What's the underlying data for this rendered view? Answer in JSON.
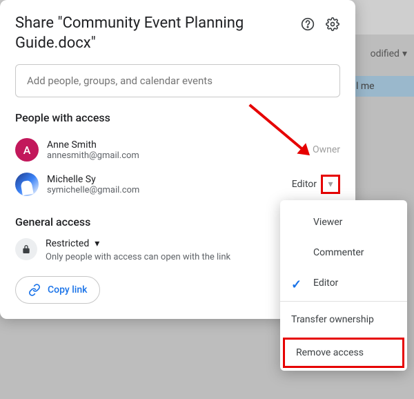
{
  "backdrop": {
    "column_label": "odified",
    "row_label": "l me"
  },
  "dialog": {
    "title": "Share \"Community Event Planning Guide.docx\"",
    "input_placeholder": "Add people, groups, and calendar events",
    "people_section": "People with access",
    "general_section": "General access",
    "copy_link": "Copy link"
  },
  "people": [
    {
      "avatar_letter": "A",
      "name": "Anne Smith",
      "email": "annesmith@gmail.com",
      "role": "Owner"
    },
    {
      "avatar_letter": "",
      "name": "Michelle Sy",
      "email": "symichelle@gmail.com",
      "role": "Editor"
    }
  ],
  "access": {
    "level": "Restricted",
    "description": "Only people with access can open with the link"
  },
  "menu": {
    "viewer": "Viewer",
    "commenter": "Commenter",
    "editor": "Editor",
    "transfer": "Transfer ownership",
    "remove": "Remove access"
  }
}
